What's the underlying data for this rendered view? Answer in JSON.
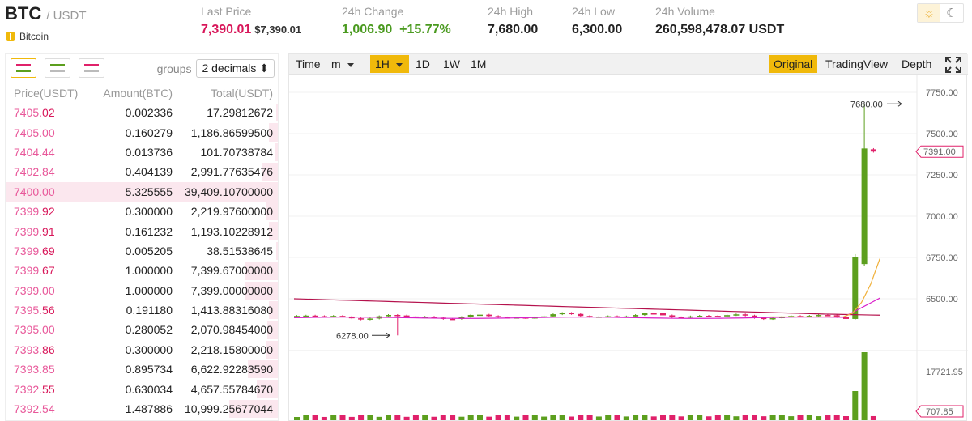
{
  "header": {
    "symbol": "BTC",
    "quote": "/ USDT",
    "coin_name": "Bitcoin",
    "last_price_label": "Last Price",
    "last_price": "7,390.01",
    "last_price_usd": "$7,390.01",
    "change_label": "24h Change",
    "change_value": "1,006.90",
    "change_pct": "+15.77%",
    "high_label": "24h High",
    "high_value": "7,680.00",
    "low_label": "24h Low",
    "low_value": "6,300.00",
    "volume_label": "24h Volume",
    "volume_value": "260,598,478.07 USDT",
    "theme_light_icon": "sun-icon",
    "theme_dark_icon": "moon-icon"
  },
  "orderbook": {
    "groups_label": "groups",
    "groups_value": "2 decimals",
    "col_price": "Price(USDT)",
    "col_amount": "Amount(BTC)",
    "col_total": "Total(USDT)",
    "rows": [
      {
        "p1": "7405.",
        "p2": "02",
        "amount": "0.002336",
        "total": "17.29812672",
        "depth": 0.01
      },
      {
        "p1": "7405.00",
        "p2": "",
        "amount": "0.160279",
        "total": "1,186.86599500",
        "depth": 0.05
      },
      {
        "p1": "7404.44",
        "p2": "",
        "amount": "0.013736",
        "total": "101.70738784",
        "depth": 0.02
      },
      {
        "p1": "7402.84",
        "p2": "",
        "amount": "0.404139",
        "total": "2,991.77635476",
        "depth": 0.09
      },
      {
        "p1": "7400.00",
        "p2": "",
        "amount": "5.325555",
        "total": "39,409.10700000",
        "depth": 1.0
      },
      {
        "p1": "7399.",
        "p2": "92",
        "amount": "0.300000",
        "total": "2,219.97600000",
        "depth": 0.07
      },
      {
        "p1": "7399.",
        "p2": "91",
        "amount": "0.161232",
        "total": "1,193.10228912",
        "depth": 0.05
      },
      {
        "p1": "7399.",
        "p2": "69",
        "amount": "0.005205",
        "total": "38.51538645",
        "depth": 0.01
      },
      {
        "p1": "7399.",
        "p2": "67",
        "amount": "1.000000",
        "total": "7,399.67000000",
        "depth": 0.19
      },
      {
        "p1": "7399.00",
        "p2": "",
        "amount": "1.000000",
        "total": "7,399.00000000",
        "depth": 0.19
      },
      {
        "p1": "7395.",
        "p2": "56",
        "amount": "0.191180",
        "total": "1,413.88316080",
        "depth": 0.05
      },
      {
        "p1": "7395.00",
        "p2": "",
        "amount": "0.280052",
        "total": "2,070.98454000",
        "depth": 0.06
      },
      {
        "p1": "7393.",
        "p2": "86",
        "amount": "0.300000",
        "total": "2,218.15800000",
        "depth": 0.07
      },
      {
        "p1": "7393.85",
        "p2": "",
        "amount": "0.895734",
        "total": "6,622.92283590",
        "depth": 0.17
      },
      {
        "p1": "7392.",
        "p2": "55",
        "amount": "0.630034",
        "total": "4,657.55784670",
        "depth": 0.12
      },
      {
        "p1": "7392.54",
        "p2": "",
        "amount": "1.487886",
        "total": "10,999.25677044",
        "depth": 0.28
      }
    ]
  },
  "toolbar": {
    "time_label": "Time",
    "minute_label": "m",
    "hour_label": "1H",
    "day_label": "1D",
    "week_label": "1W",
    "month_label": "1M",
    "original_label": "Original",
    "tradingview_label": "TradingView",
    "depth_label": "Depth",
    "fullscreen_icon": "expand-icon"
  },
  "chart_data": {
    "type": "candlestick",
    "interval": "1H",
    "price_axis_ticks": [
      7750,
      7500,
      7250,
      7000,
      6750,
      6500
    ],
    "price_tick_labels": [
      "7750.00",
      "7500.00",
      "7250.00",
      "7000.00",
      "6750.00",
      "6500.00"
    ],
    "ylim": [
      6250,
      7780
    ],
    "high_annotation": "7680.00",
    "low_annotation": "6278.00",
    "last_price_tag": "7391.00",
    "volume_max_label": "17721.95",
    "last_volume_tag": "707.85",
    "colors": {
      "up": "#5c9f1e",
      "down": "#e0216a",
      "ma_slow": "#b5124d",
      "ma_mid": "#d91fc9",
      "ma_fast": "#f0b03a"
    }
  }
}
